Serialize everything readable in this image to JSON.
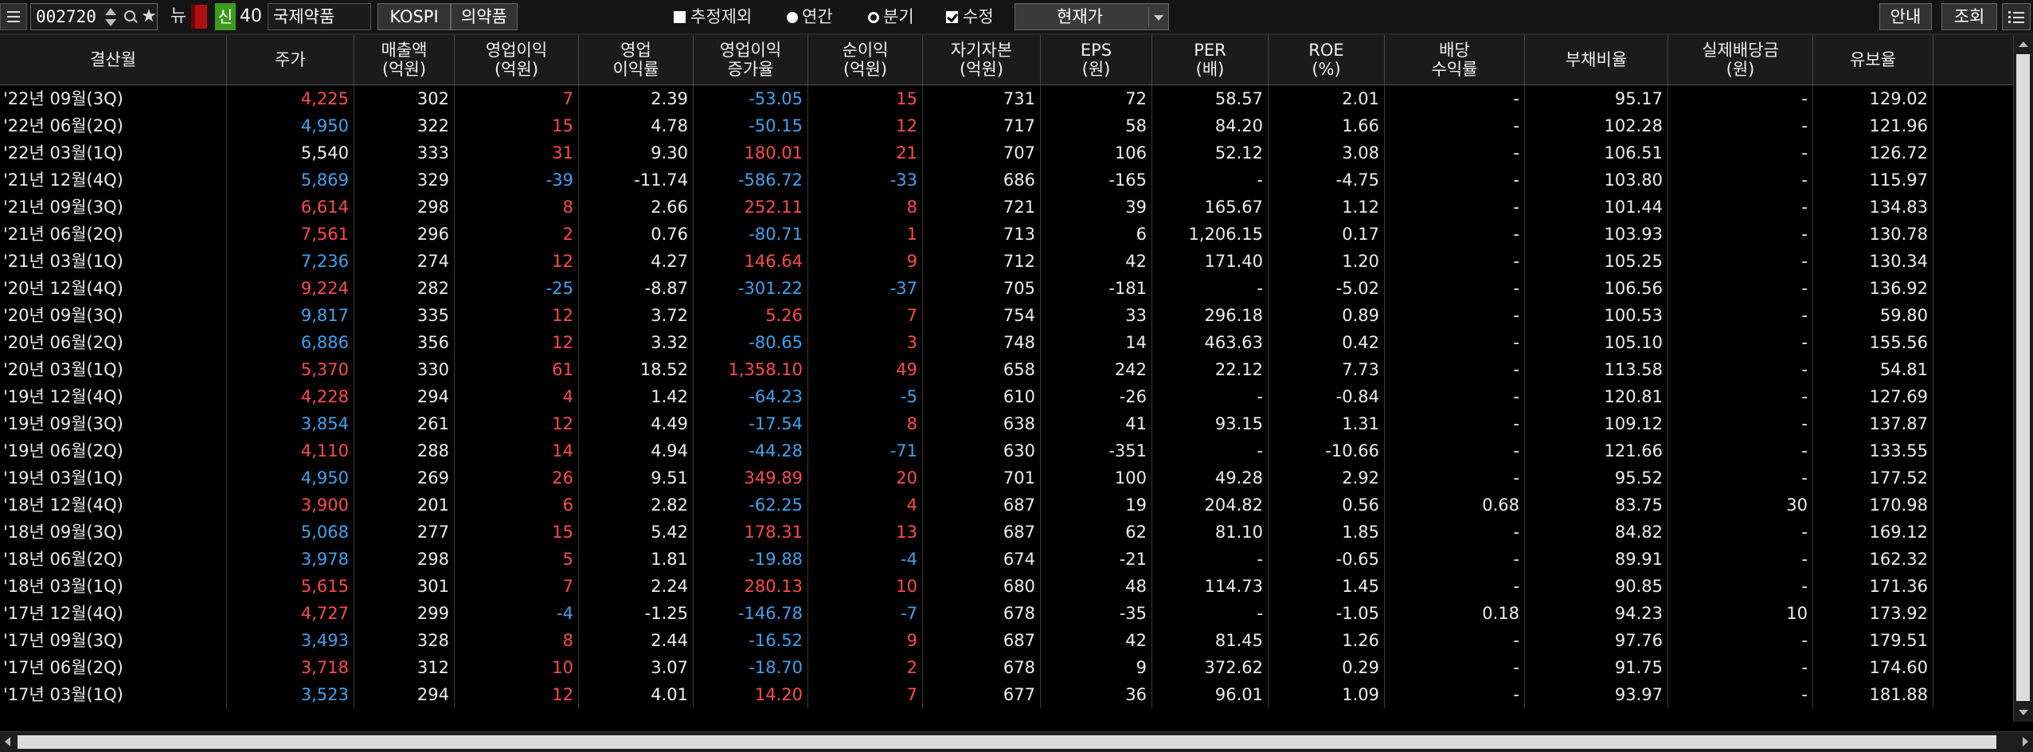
{
  "toolbar": {
    "stock_code": "002720",
    "new_badge": "뉴",
    "sin_badge": "신",
    "sin_number": "40",
    "company_name": "국제약품",
    "market_button": "KOSPI",
    "sector_button": "의약품",
    "options": {
      "exclude_estimate": "추정제외",
      "annual": "연간",
      "quarterly": "분기",
      "revised": "수정"
    },
    "price_basis": "현재가",
    "guide_button": "안내",
    "inquiry_button": "조회",
    "icons": [
      "menu-icon",
      "spin-icon",
      "search-icon",
      "star-icon",
      "list-icon"
    ]
  },
  "colors": {
    "up": "#ff4b4b",
    "down": "#3fa3f0",
    "sin_badge": "#3c9a1c",
    "flag": "#b01010"
  },
  "table": {
    "columns": [
      {
        "key": "period",
        "label": "결산월"
      },
      {
        "key": "price",
        "label": "주가"
      },
      {
        "key": "sales",
        "label": "매출액\n(억원)"
      },
      {
        "key": "op_income",
        "label": "영업이익\n(억원)"
      },
      {
        "key": "op_margin",
        "label": "영업\n이익률"
      },
      {
        "key": "op_growth",
        "label": "영업이익\n증가율"
      },
      {
        "key": "net_income",
        "label": "순이익\n(억원)"
      },
      {
        "key": "equity",
        "label": "자기자본\n(억원)"
      },
      {
        "key": "eps",
        "label": "EPS\n(원)"
      },
      {
        "key": "per",
        "label": "PER\n(배)"
      },
      {
        "key": "roe",
        "label": "ROE\n(%)"
      },
      {
        "key": "div_yield",
        "label": "배당\n수익률"
      },
      {
        "key": "debt_ratio",
        "label": "부채비율"
      },
      {
        "key": "div_paid",
        "label": "실제배당금\n(원)"
      },
      {
        "key": "reserve_ratio",
        "label": "유보율"
      }
    ],
    "rows": [
      {
        "period": "'22년 09월(3Q)",
        "price": "4,225",
        "price_dir": "up",
        "sales": "302",
        "op_income": "7",
        "op_dir": "up",
        "op_margin": "2.39",
        "op_growth": "-53.05",
        "growth_dir": "dn",
        "net_income": "15",
        "net_dir": "up",
        "equity": "731",
        "eps": "72",
        "per": "58.57",
        "roe": "2.01",
        "div_yield": "-",
        "debt_ratio": "95.17",
        "div_paid": "-",
        "reserve_ratio": "129.02"
      },
      {
        "period": "'22년 06월(2Q)",
        "price": "4,950",
        "price_dir": "dn",
        "sales": "322",
        "op_income": "15",
        "op_dir": "up",
        "op_margin": "4.78",
        "op_growth": "-50.15",
        "growth_dir": "dn",
        "net_income": "12",
        "net_dir": "up",
        "equity": "717",
        "eps": "58",
        "per": "84.20",
        "roe": "1.66",
        "div_yield": "-",
        "debt_ratio": "102.28",
        "div_paid": "-",
        "reserve_ratio": "121.96"
      },
      {
        "period": "'22년 03월(1Q)",
        "price": "5,540",
        "price_dir": "",
        "sales": "333",
        "op_income": "31",
        "op_dir": "up",
        "op_margin": "9.30",
        "op_growth": "180.01",
        "growth_dir": "up",
        "net_income": "21",
        "net_dir": "up",
        "equity": "707",
        "eps": "106",
        "per": "52.12",
        "roe": "3.08",
        "div_yield": "-",
        "debt_ratio": "106.51",
        "div_paid": "-",
        "reserve_ratio": "126.72"
      },
      {
        "period": "'21년 12월(4Q)",
        "price": "5,869",
        "price_dir": "dn",
        "sales": "329",
        "op_income": "-39",
        "op_dir": "dn",
        "op_margin": "-11.74",
        "op_growth": "-586.72",
        "growth_dir": "dn",
        "net_income": "-33",
        "net_dir": "dn",
        "equity": "686",
        "eps": "-165",
        "per": "-",
        "roe": "-4.75",
        "div_yield": "-",
        "debt_ratio": "103.80",
        "div_paid": "-",
        "reserve_ratio": "115.97"
      },
      {
        "period": "'21년 09월(3Q)",
        "price": "6,614",
        "price_dir": "up",
        "sales": "298",
        "op_income": "8",
        "op_dir": "up",
        "op_margin": "2.66",
        "op_growth": "252.11",
        "growth_dir": "up",
        "net_income": "8",
        "net_dir": "up",
        "equity": "721",
        "eps": "39",
        "per": "165.67",
        "roe": "1.12",
        "div_yield": "-",
        "debt_ratio": "101.44",
        "div_paid": "-",
        "reserve_ratio": "134.83"
      },
      {
        "period": "'21년 06월(2Q)",
        "price": "7,561",
        "price_dir": "up",
        "sales": "296",
        "op_income": "2",
        "op_dir": "up",
        "op_margin": "0.76",
        "op_growth": "-80.71",
        "growth_dir": "dn",
        "net_income": "1",
        "net_dir": "up",
        "equity": "713",
        "eps": "6",
        "per": "1,206.15",
        "roe": "0.17",
        "div_yield": "-",
        "debt_ratio": "103.93",
        "div_paid": "-",
        "reserve_ratio": "130.78"
      },
      {
        "period": "'21년 03월(1Q)",
        "price": "7,236",
        "price_dir": "dn",
        "sales": "274",
        "op_income": "12",
        "op_dir": "up",
        "op_margin": "4.27",
        "op_growth": "146.64",
        "growth_dir": "up",
        "net_income": "9",
        "net_dir": "up",
        "equity": "712",
        "eps": "42",
        "per": "171.40",
        "roe": "1.20",
        "div_yield": "-",
        "debt_ratio": "105.25",
        "div_paid": "-",
        "reserve_ratio": "130.34"
      },
      {
        "period": "'20년 12월(4Q)",
        "price": "9,224",
        "price_dir": "up",
        "sales": "282",
        "op_income": "-25",
        "op_dir": "dn",
        "op_margin": "-8.87",
        "op_growth": "-301.22",
        "growth_dir": "dn",
        "net_income": "-37",
        "net_dir": "dn",
        "equity": "705",
        "eps": "-181",
        "per": "-",
        "roe": "-5.02",
        "div_yield": "-",
        "debt_ratio": "106.56",
        "div_paid": "-",
        "reserve_ratio": "136.92"
      },
      {
        "period": "'20년 09월(3Q)",
        "price": "9,817",
        "price_dir": "dn",
        "sales": "335",
        "op_income": "12",
        "op_dir": "up",
        "op_margin": "3.72",
        "op_growth": "5.26",
        "growth_dir": "up",
        "net_income": "7",
        "net_dir": "up",
        "equity": "754",
        "eps": "33",
        "per": "296.18",
        "roe": "0.89",
        "div_yield": "-",
        "debt_ratio": "100.53",
        "div_paid": "-",
        "reserve_ratio": "59.80"
      },
      {
        "period": "'20년 06월(2Q)",
        "price": "6,886",
        "price_dir": "dn",
        "sales": "356",
        "op_income": "12",
        "op_dir": "up",
        "op_margin": "3.32",
        "op_growth": "-80.65",
        "growth_dir": "dn",
        "net_income": "3",
        "net_dir": "up",
        "equity": "748",
        "eps": "14",
        "per": "463.63",
        "roe": "0.42",
        "div_yield": "-",
        "debt_ratio": "105.10",
        "div_paid": "-",
        "reserve_ratio": "155.56"
      },
      {
        "period": "'20년 03월(1Q)",
        "price": "5,370",
        "price_dir": "up",
        "sales": "330",
        "op_income": "61",
        "op_dir": "up",
        "op_margin": "18.52",
        "op_growth": "1,358.10",
        "growth_dir": "up",
        "net_income": "49",
        "net_dir": "up",
        "equity": "658",
        "eps": "242",
        "per": "22.12",
        "roe": "7.73",
        "div_yield": "-",
        "debt_ratio": "113.58",
        "div_paid": "-",
        "reserve_ratio": "54.81"
      },
      {
        "period": "'19년 12월(4Q)",
        "price": "4,228",
        "price_dir": "up",
        "sales": "294",
        "op_income": "4",
        "op_dir": "up",
        "op_margin": "1.42",
        "op_growth": "-64.23",
        "growth_dir": "dn",
        "net_income": "-5",
        "net_dir": "dn",
        "equity": "610",
        "eps": "-26",
        "per": "-",
        "roe": "-0.84",
        "div_yield": "-",
        "debt_ratio": "120.81",
        "div_paid": "-",
        "reserve_ratio": "127.69"
      },
      {
        "period": "'19년 09월(3Q)",
        "price": "3,854",
        "price_dir": "dn",
        "sales": "261",
        "op_income": "12",
        "op_dir": "up",
        "op_margin": "4.49",
        "op_growth": "-17.54",
        "growth_dir": "dn",
        "net_income": "8",
        "net_dir": "up",
        "equity": "638",
        "eps": "41",
        "per": "93.15",
        "roe": "1.31",
        "div_yield": "-",
        "debt_ratio": "109.12",
        "div_paid": "-",
        "reserve_ratio": "137.87"
      },
      {
        "period": "'19년 06월(2Q)",
        "price": "4,110",
        "price_dir": "up",
        "sales": "288",
        "op_income": "14",
        "op_dir": "up",
        "op_margin": "4.94",
        "op_growth": "-44.28",
        "growth_dir": "dn",
        "net_income": "-71",
        "net_dir": "dn",
        "equity": "630",
        "eps": "-351",
        "per": "-",
        "roe": "-10.66",
        "div_yield": "-",
        "debt_ratio": "121.66",
        "div_paid": "-",
        "reserve_ratio": "133.55"
      },
      {
        "period": "'19년 03월(1Q)",
        "price": "4,950",
        "price_dir": "dn",
        "sales": "269",
        "op_income": "26",
        "op_dir": "up",
        "op_margin": "9.51",
        "op_growth": "349.89",
        "growth_dir": "up",
        "net_income": "20",
        "net_dir": "up",
        "equity": "701",
        "eps": "100",
        "per": "49.28",
        "roe": "2.92",
        "div_yield": "-",
        "debt_ratio": "95.52",
        "div_paid": "-",
        "reserve_ratio": "177.52"
      },
      {
        "period": "'18년 12월(4Q)",
        "price": "3,900",
        "price_dir": "up",
        "sales": "201",
        "op_income": "6",
        "op_dir": "up",
        "op_margin": "2.82",
        "op_growth": "-62.25",
        "growth_dir": "dn",
        "net_income": "4",
        "net_dir": "up",
        "equity": "687",
        "eps": "19",
        "per": "204.82",
        "roe": "0.56",
        "div_yield": "0.68",
        "debt_ratio": "83.75",
        "div_paid": "30",
        "reserve_ratio": "170.98"
      },
      {
        "period": "'18년 09월(3Q)",
        "price": "5,068",
        "price_dir": "dn",
        "sales": "277",
        "op_income": "15",
        "op_dir": "up",
        "op_margin": "5.42",
        "op_growth": "178.31",
        "growth_dir": "up",
        "net_income": "13",
        "net_dir": "up",
        "equity": "687",
        "eps": "62",
        "per": "81.10",
        "roe": "1.85",
        "div_yield": "-",
        "debt_ratio": "84.82",
        "div_paid": "-",
        "reserve_ratio": "169.12"
      },
      {
        "period": "'18년 06월(2Q)",
        "price": "3,978",
        "price_dir": "dn",
        "sales": "298",
        "op_income": "5",
        "op_dir": "up",
        "op_margin": "1.81",
        "op_growth": "-19.88",
        "growth_dir": "dn",
        "net_income": "-4",
        "net_dir": "dn",
        "equity": "674",
        "eps": "-21",
        "per": "-",
        "roe": "-0.65",
        "div_yield": "-",
        "debt_ratio": "89.91",
        "div_paid": "-",
        "reserve_ratio": "162.32"
      },
      {
        "period": "'18년 03월(1Q)",
        "price": "5,615",
        "price_dir": "up",
        "sales": "301",
        "op_income": "7",
        "op_dir": "up",
        "op_margin": "2.24",
        "op_growth": "280.13",
        "growth_dir": "up",
        "net_income": "10",
        "net_dir": "up",
        "equity": "680",
        "eps": "48",
        "per": "114.73",
        "roe": "1.45",
        "div_yield": "-",
        "debt_ratio": "90.85",
        "div_paid": "-",
        "reserve_ratio": "171.36"
      },
      {
        "period": "'17년 12월(4Q)",
        "price": "4,727",
        "price_dir": "up",
        "sales": "299",
        "op_income": "-4",
        "op_dir": "dn",
        "op_margin": "-1.25",
        "op_growth": "-146.78",
        "growth_dir": "dn",
        "net_income": "-7",
        "net_dir": "dn",
        "equity": "678",
        "eps": "-35",
        "per": "-",
        "roe": "-1.05",
        "div_yield": "0.18",
        "debt_ratio": "94.23",
        "div_paid": "10",
        "reserve_ratio": "173.92"
      },
      {
        "period": "'17년 09월(3Q)",
        "price": "3,493",
        "price_dir": "dn",
        "sales": "328",
        "op_income": "8",
        "op_dir": "up",
        "op_margin": "2.44",
        "op_growth": "-16.52",
        "growth_dir": "dn",
        "net_income": "9",
        "net_dir": "up",
        "equity": "687",
        "eps": "42",
        "per": "81.45",
        "roe": "1.26",
        "div_yield": "-",
        "debt_ratio": "97.76",
        "div_paid": "-",
        "reserve_ratio": "179.51"
      },
      {
        "period": "'17년 06월(2Q)",
        "price": "3,718",
        "price_dir": "up",
        "sales": "312",
        "op_income": "10",
        "op_dir": "up",
        "op_margin": "3.07",
        "op_growth": "-18.70",
        "growth_dir": "dn",
        "net_income": "2",
        "net_dir": "up",
        "equity": "678",
        "eps": "9",
        "per": "372.62",
        "roe": "0.29",
        "div_yield": "-",
        "debt_ratio": "91.75",
        "div_paid": "-",
        "reserve_ratio": "174.60"
      },
      {
        "period": "'17년 03월(1Q)",
        "price": "3,523",
        "price_dir": "dn",
        "sales": "294",
        "op_income": "12",
        "op_dir": "up",
        "op_margin": "4.01",
        "op_growth": "14.20",
        "growth_dir": "up",
        "net_income": "7",
        "net_dir": "up",
        "equity": "677",
        "eps": "36",
        "per": "96.01",
        "roe": "1.09",
        "div_yield": "-",
        "debt_ratio": "93.97",
        "div_paid": "-",
        "reserve_ratio": "181.88"
      }
    ]
  }
}
